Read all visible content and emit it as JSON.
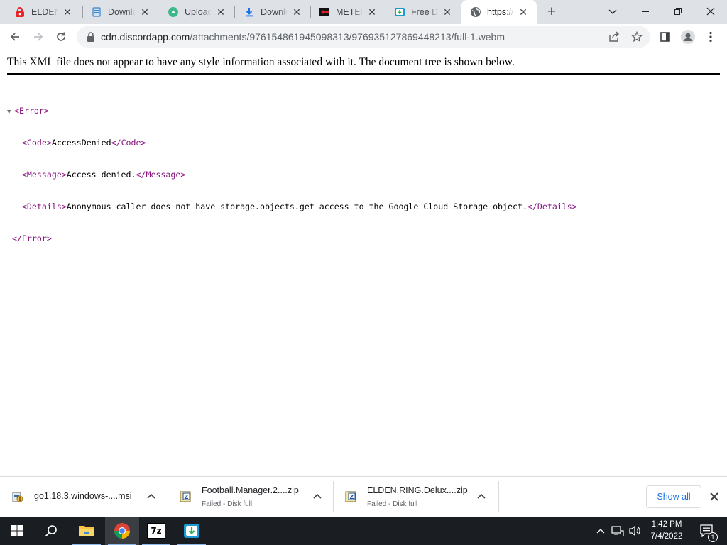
{
  "browser": {
    "tabs": [
      {
        "title": "ELDEN RING",
        "icon": "red-lock-icon",
        "active": false
      },
      {
        "title": "Download",
        "icon": "document-icon",
        "active": false
      },
      {
        "title": "Upload",
        "icon": "green-leaf-icon",
        "active": false
      },
      {
        "title": "Download",
        "icon": "download-arrow-icon",
        "active": false
      },
      {
        "title": "METER",
        "icon": "meter-icon",
        "active": false
      },
      {
        "title": "Free Download",
        "icon": "free-download-icon",
        "active": false
      },
      {
        "title": "https://cdn.discordapp.com",
        "icon": "globe-icon",
        "active": true
      }
    ],
    "new_tab_label": "+",
    "url_host": "cdn.discordapp.com",
    "url_path": "/attachments/976154861945098313/976935127869448213/full-1.webm"
  },
  "page": {
    "header_text": "This XML file does not appear to have any style information associated with it. The document tree is shown below.",
    "xml": {
      "root_open": "<Error>",
      "code_open": "<Code>",
      "code_value": "AccessDenied",
      "code_close": "</Code>",
      "message_open": "<Message>",
      "message_value": "Access denied.",
      "message_close": "</Message>",
      "details_open": "<Details>",
      "details_value": "Anonymous caller does not have storage.objects.get access to the Google Cloud Storage object.",
      "details_close": "</Details>",
      "root_close": "</Error>"
    }
  },
  "downloads": {
    "items": [
      {
        "name": "go1.18.3.windows-....msi",
        "status": "",
        "icon": "msi-installer-icon"
      },
      {
        "name": "Football.Manager.2....zip",
        "status": "Failed - Disk full",
        "icon": "zip-archive-icon"
      },
      {
        "name": "ELDEN.RING.Delux....zip",
        "status": "Failed - Disk full",
        "icon": "zip-archive-icon"
      }
    ],
    "show_all_label": "Show all"
  },
  "taskbar": {
    "apps": [
      "start",
      "search",
      "file-explorer",
      "chrome",
      "7-zip",
      "free-download-manager"
    ],
    "seven_zip_label": "7z",
    "time": "1:42 PM",
    "date": "7/4/2022",
    "notification_count": "1"
  },
  "colors": {
    "tab_strip": "#dee1e6",
    "xml_tag": "#881280",
    "accent_blue": "#1a73e8",
    "taskbar": "#1a1d21"
  }
}
